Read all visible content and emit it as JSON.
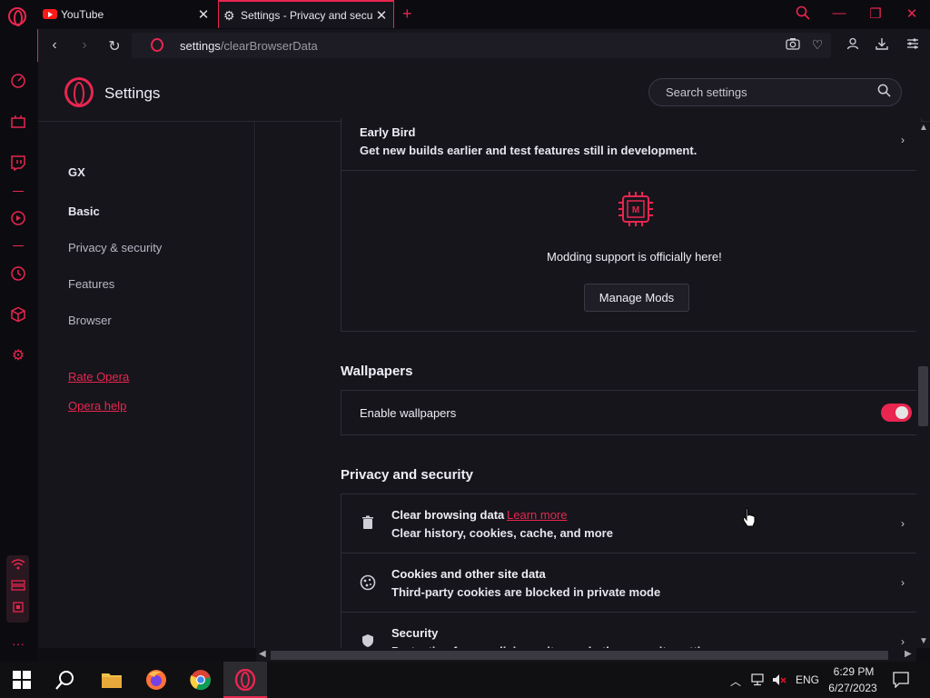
{
  "tabs": [
    {
      "title": "YouTube",
      "icon": "youtube-icon"
    },
    {
      "title": "Settings - Privacy and security",
      "icon": "gear-icon"
    }
  ],
  "address": {
    "host": "settings",
    "path": "/clearBrowserData"
  },
  "header": {
    "title": "Settings",
    "search_placeholder": "Search settings"
  },
  "leftnav": {
    "items": [
      "GX",
      "Basic",
      "Privacy & security",
      "Features",
      "Browser"
    ],
    "links": [
      "Rate Opera",
      "Opera help"
    ]
  },
  "main": {
    "early_bird": {
      "title": "Early Bird",
      "subtitle": "Get new builds earlier and test features still in development."
    },
    "mods": {
      "text": "Modding support is officially here!",
      "button": "Manage Mods"
    },
    "wallpapers": {
      "heading": "Wallpapers",
      "label": "Enable wallpapers",
      "enabled": true
    },
    "privacy": {
      "heading": "Privacy and security",
      "rows": [
        {
          "title": "Clear browsing data",
          "link": "Learn more",
          "subtitle": "Clear history, cookies, cache, and more",
          "icon": "trash-icon"
        },
        {
          "title": "Cookies and other site data",
          "subtitle": "Third-party cookies are blocked in private mode",
          "icon": "cookie-icon"
        },
        {
          "title": "Security",
          "subtitle": "Protection from malicious sites and other security settings",
          "icon": "shield-icon"
        }
      ]
    }
  },
  "taskbar": {
    "lang": "ENG",
    "time": "6:29 PM",
    "date": "6/27/2023"
  },
  "colors": {
    "accent": "#e8264f",
    "background": "#16151c"
  }
}
